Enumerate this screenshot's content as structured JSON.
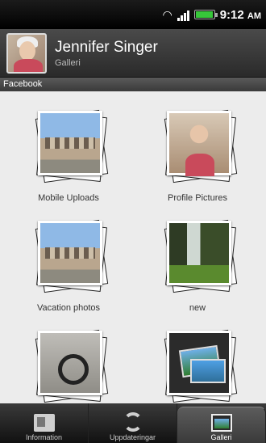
{
  "status_bar": {
    "time": "9:12",
    "am_pm": "AM",
    "icons": [
      "wifi-icon",
      "signal-icon",
      "battery-icon"
    ],
    "battery_color": "#37c73a"
  },
  "header": {
    "name": "Jennifer Singer",
    "subtitle": "Galleri"
  },
  "section": {
    "label": "Facebook"
  },
  "albums": [
    {
      "label": "Mobile Uploads",
      "photo": "building"
    },
    {
      "label": "Profile Pictures",
      "photo": "portrait"
    },
    {
      "label": "Vacation photos",
      "photo": "building"
    },
    {
      "label": "new",
      "photo": "waterfall"
    },
    {
      "label": "",
      "photo": "headphones"
    },
    {
      "label": "",
      "photo": "gallery"
    }
  ],
  "tabs": [
    {
      "label": "Information",
      "icon": "info-card-icon",
      "active": false
    },
    {
      "label": "Uppdateringar",
      "icon": "sync-icon",
      "active": false
    },
    {
      "label": "Galleri",
      "icon": "gallery-icon",
      "active": true
    }
  ]
}
